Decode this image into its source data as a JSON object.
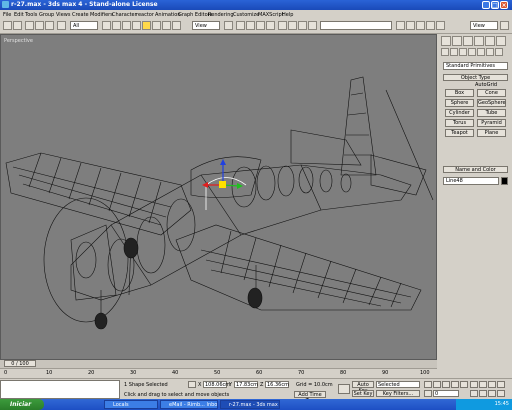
{
  "window": {
    "title": "r-27.max - 3ds max 4 - Stand-alone License"
  },
  "menu": [
    "File",
    "Edit",
    "Tools",
    "Group",
    "Views",
    "Create",
    "Modifiers",
    "Character",
    "reactor",
    "Animation",
    "Graph Editors",
    "Rendering",
    "Customize",
    "MAXScript",
    "Help"
  ],
  "toolbar": {
    "selection_filter": "All",
    "coordinate_system": "View",
    "named_selection": "",
    "right_view": "View"
  },
  "viewport": {
    "label": "Perspective"
  },
  "command_panel": {
    "category_dropdown": "Standard Primitives",
    "object_type_header": "Object Type",
    "autogrid_label": "AutoGrid",
    "object_buttons": [
      "Box",
      "Cone",
      "Sphere",
      "GeoSphere",
      "Cylinder",
      "Tube",
      "Torus",
      "Pyramid",
      "Teapot",
      "Plane"
    ],
    "name_color_header": "Name and Color",
    "name_value": "Line48",
    "color": "#000000"
  },
  "time": {
    "slider_label": "0 / 100",
    "ticks": [
      "0",
      "10",
      "20",
      "30",
      "40",
      "50",
      "60",
      "70",
      "80",
      "90",
      "100"
    ]
  },
  "status": {
    "selection": "1 Shape Selected",
    "prompt": "Click and drag to select and move objects",
    "x_label": "X",
    "x_value": "108.06cm",
    "y_label": "Y",
    "y_value": "17.83cm",
    "z_label": "Z",
    "z_value": "16.36cm",
    "grid_label": "Grid = 10.0cm",
    "add_time_tag": "Add Time Tag",
    "auto_key": "Auto Key",
    "set_key": "Set Key",
    "key_mode_value": "Selected",
    "key_filters": "Key Filters...",
    "frame_value": "0"
  },
  "taskbar": {
    "start_label": "Iniciar",
    "items": [
      "Locals",
      "eMail - Rimb... Inbox",
      "r-27.max - 3ds max 4..."
    ],
    "clock": "15:45"
  },
  "colors": {
    "viewport_bg": "#7e7e7e",
    "wireframe": "#111111",
    "selection": "#ffffff",
    "gizmo_x": "#e02020",
    "gizmo_y": "#20c020",
    "gizmo_z": "#2040e0"
  }
}
